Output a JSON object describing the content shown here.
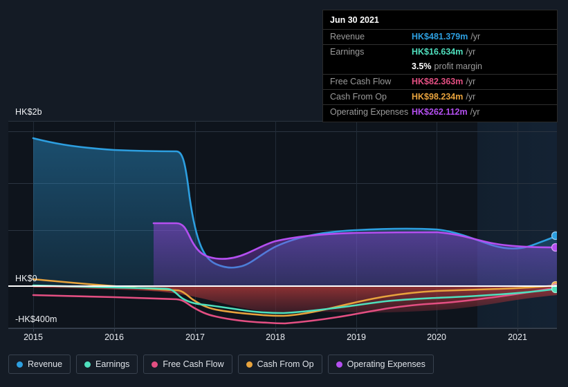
{
  "tooltip": {
    "date": "Jun 30 2021",
    "rows": [
      {
        "label": "Revenue",
        "value": "HK$481.379m",
        "unit": "/yr",
        "color": "#2d9fe0"
      },
      {
        "label": "Earnings",
        "value": "HK$16.634m",
        "unit": "/yr",
        "color": "#4fdfbd"
      },
      {
        "label": "Free Cash Flow",
        "value": "HK$82.363m",
        "unit": "/yr",
        "color": "#e34f82"
      },
      {
        "label": "Cash From Op",
        "value": "HK$98.234m",
        "unit": "/yr",
        "color": "#e8a33d"
      },
      {
        "label": "Operating Expenses",
        "value": "HK$262.112m",
        "unit": "/yr",
        "color": "#b44ff0"
      }
    ],
    "profit_margin_value": "3.5%",
    "profit_margin_label": "profit margin"
  },
  "legend": [
    {
      "label": "Revenue",
      "color": "#2d9fe0"
    },
    {
      "label": "Earnings",
      "color": "#4fdfbd"
    },
    {
      "label": "Free Cash Flow",
      "color": "#e34f82"
    },
    {
      "label": "Cash From Op",
      "color": "#e8a33d"
    },
    {
      "label": "Operating Expenses",
      "color": "#b44ff0"
    }
  ],
  "axis": {
    "y_labels": [
      {
        "text": "HK$2b",
        "top": 155
      },
      {
        "text": "HK$0",
        "top": 396
      },
      {
        "text": "-HK$400m",
        "top": 455
      }
    ],
    "x_labels": [
      "2015",
      "2016",
      "2017",
      "2018",
      "2019",
      "2020",
      "2021"
    ]
  },
  "chart_data": {
    "type": "area",
    "title": "",
    "xlabel": "",
    "ylabel": "",
    "ylim": [
      -400,
      2000
    ],
    "yunit": "HK$ millions",
    "ytick_values": [
      2000,
      0,
      -400
    ],
    "ytick_labels": [
      "HK$2b",
      "HK$0",
      "-HK$400m"
    ],
    "xlim": [
      "2015",
      "2021.5"
    ],
    "xtick_labels": [
      "2015",
      "2016",
      "2017",
      "2018",
      "2019",
      "2020",
      "2021"
    ],
    "grid": true,
    "legend_position": "bottom",
    "forecast_region_start": "2020.5",
    "x": [
      2015.0,
      2015.5,
      2016.0,
      2016.5,
      2016.75,
      2017.0,
      2017.25,
      2017.5,
      2017.75,
      2018.0,
      2018.5,
      2019.0,
      2019.5,
      2020.0,
      2020.5,
      2021.0,
      2021.5
    ],
    "series": [
      {
        "name": "Revenue",
        "color": "#2d9fe0",
        "values": [
          1860,
          1760,
          1700,
          1690,
          1690,
          820,
          560,
          440,
          520,
          600,
          640,
          680,
          700,
          700,
          640,
          580,
          620
        ]
      },
      {
        "name": "Earnings",
        "color": "#4fdfbd",
        "values": [
          14,
          10,
          5,
          -5,
          -10,
          -30,
          -55,
          -110,
          -140,
          -170,
          -150,
          -90,
          -20,
          5,
          8,
          12,
          17
        ]
      },
      {
        "name": "Free Cash Flow",
        "color": "#e34f82",
        "values": [
          -95,
          -100,
          -105,
          -110,
          -112,
          -115,
          -150,
          -195,
          -240,
          -258,
          -230,
          -175,
          -110,
          -55,
          -45,
          -35,
          82
        ]
      },
      {
        "name": "Cash From Op",
        "color": "#e8a33d",
        "values": [
          75,
          55,
          35,
          15,
          10,
          0,
          -55,
          -120,
          -165,
          -175,
          -140,
          -80,
          -20,
          10,
          15,
          20,
          98
        ]
      },
      {
        "name": "Operating Expenses",
        "color": "#b44ff0",
        "values": [
          null,
          null,
          null,
          630,
          630,
          430,
          330,
          300,
          320,
          370,
          400,
          420,
          430,
          430,
          390,
          340,
          330
        ]
      }
    ]
  }
}
